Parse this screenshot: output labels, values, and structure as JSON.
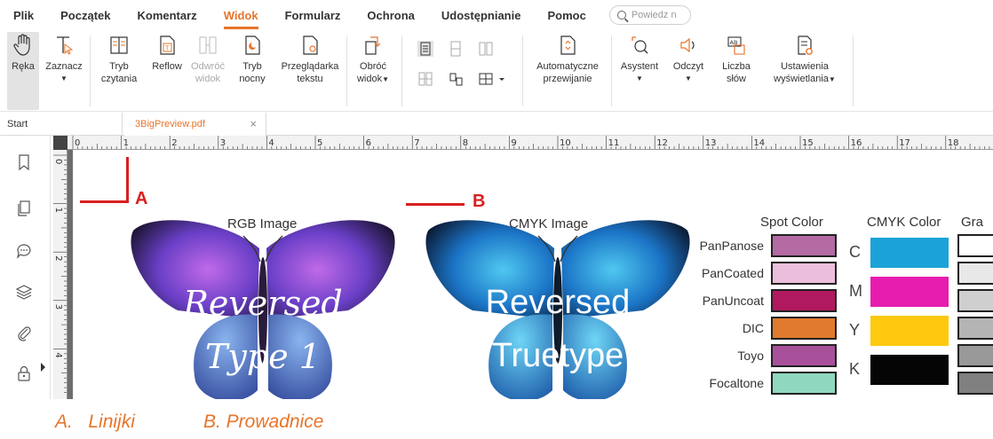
{
  "menu": {
    "items": [
      {
        "label": "Plik",
        "active": false
      },
      {
        "label": "Początek",
        "active": false
      },
      {
        "label": "Komentarz",
        "active": false
      },
      {
        "label": "Widok",
        "active": true
      },
      {
        "label": "Formularz",
        "active": false
      },
      {
        "label": "Ochrona",
        "active": false
      },
      {
        "label": "Udostępnianie",
        "active": false
      },
      {
        "label": "Pomoc",
        "active": false
      }
    ],
    "tell_me_placeholder": "Powiedz n"
  },
  "ribbon": {
    "hand": "Ręka",
    "select": "Zaznacz",
    "reading_mode_1": "Tryb",
    "reading_mode_2": "czytania",
    "reflow": "Reflow",
    "reverse_view_1": "Odwróć",
    "reverse_view_2": "widok",
    "night_mode_1": "Tryb",
    "night_mode_2": "nocny",
    "text_viewer_1": "Przeglądarka",
    "text_viewer_2": "tekstu",
    "rotate_view_1": "Obróć",
    "rotate_view_2": "widok",
    "auto_scroll_1": "Automatyczne",
    "auto_scroll_2": "przewijanie",
    "assistant": "Asystent",
    "read": "Odczyt",
    "word_count_1": "Liczba",
    "word_count_2": "słów",
    "display_settings_1": "Ustawienia",
    "display_settings_2": "wyświetlania"
  },
  "tabs": {
    "start": "Start",
    "document": "3BigPreview.pdf",
    "close": "×"
  },
  "hruler_numbers": [
    "0",
    "1",
    "2",
    "3",
    "4",
    "5",
    "6",
    "7",
    "8",
    "9",
    "10",
    "11",
    "12",
    "13",
    "14",
    "15",
    "16",
    "17",
    "18"
  ],
  "vruler_numbers": [
    "0",
    "1",
    "2",
    "3",
    "4"
  ],
  "annotations": {
    "a": "A",
    "b": "B"
  },
  "page": {
    "rgb_title": "RGB Image",
    "cmyk_title": "CMYK Image",
    "rgb_text_1": "Reversed",
    "rgb_text_2": "Type 1",
    "cmyk_text_1": "Reversed",
    "cmyk_text_2": "Truetype",
    "spot_title": "Spot Color",
    "cmyk_color_title": "CMYK Color",
    "gray_title": "Gra",
    "spot_labels": [
      "PanPanose",
      "PanCoated",
      "PanUncoat",
      "DIC",
      "Toyo",
      "Focaltone"
    ],
    "spot_colors": [
      "#b46aa3",
      "#ebbfdc",
      "#b0195f",
      "#e07a2e",
      "#a8509a",
      "#8fd8bf"
    ],
    "cmyk_letters": [
      "C",
      "M",
      "Y",
      "K"
    ],
    "cmyk_colors": [
      "#1aa3d8",
      "#e61caf",
      "#ffc90e",
      "#050505"
    ],
    "gray_colors": [
      "#ffffff",
      "#e8e8e8",
      "#cfcfcf",
      "#b4b4b4",
      "#999999",
      "#808080"
    ]
  },
  "caption": {
    "a": "A.   Linijki",
    "b": "B. Prowadnice"
  },
  "colors": {
    "accent": "#e8742a",
    "annotation": "#d92020"
  }
}
